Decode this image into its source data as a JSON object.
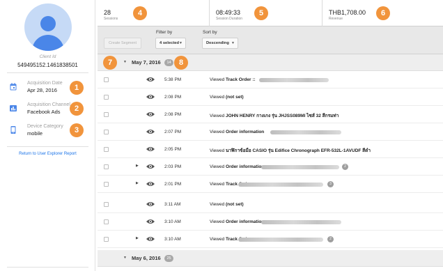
{
  "sidebar": {
    "client_label": "Client Id",
    "client_id": "549495152.1461838501",
    "attributes": [
      {
        "label": "Acquisition Date",
        "value": "Apr 28, 2016",
        "icon": "calendar-icon"
      },
      {
        "label": "Acquisition Channel",
        "value": "Facebook Ads",
        "icon": "bar-chart-icon"
      },
      {
        "label": "Device Category",
        "value": "mobile",
        "icon": "mobile-device-icon"
      }
    ],
    "return_link": "Return to User Explorer Report"
  },
  "summary": {
    "sessions": {
      "value": "28",
      "label": "Sessions"
    },
    "duration": {
      "value": "08:49:33",
      "label": "Session Duration"
    },
    "revenue": {
      "value": "THB1,708.00",
      "label": "Revenue"
    }
  },
  "toolbar": {
    "create_segment": "Create Segment",
    "filter_label": "Filter by",
    "filter_value": "4 selected",
    "sort_label": "Sort by",
    "sort_value": "Descending"
  },
  "groups": [
    {
      "date": "May 7, 2016",
      "count": "14"
    },
    {
      "date": "May 6, 2016",
      "count": "25"
    }
  ],
  "rows": [
    {
      "time": "5:38 PM",
      "prefix": "Viewed ",
      "bold": "Track Order ::",
      "rest": ""
    },
    {
      "time": "2:08 PM",
      "prefix": "Viewed ",
      "bold": "(not set)",
      "rest": ""
    },
    {
      "time": "2:08 PM",
      "prefix": "Viewed ",
      "bold": "JOHN HENRY กางเกง รุ่น JHJSS089MI ไซส์ 32 สีกรมท่า",
      "rest": ""
    },
    {
      "time": "2:07 PM",
      "prefix": "Viewed ",
      "bold": "Order information",
      "rest": ""
    },
    {
      "time": "2:05 PM",
      "prefix": "Viewed ",
      "bold": "นาฬิกาข้อมือ CASIO รุ่น Edifice Chronograph EFR-532L-1AVUDF สีดำ",
      "rest": ""
    },
    {
      "time": "2:03 PM",
      "prefix": "Viewed ",
      "bold": "Order information",
      "rest": "",
      "badge": "2"
    },
    {
      "time": "2:01 PM",
      "prefix": "Viewed ",
      "bold": "Track Order",
      "rest": "",
      "badge": "3"
    },
    {
      "time": "3:11 AM",
      "prefix": "Viewed ",
      "bold": "(not set)",
      "rest": ""
    },
    {
      "time": "3:10 AM",
      "prefix": "Viewed ",
      "bold": "Order information",
      "rest": ""
    },
    {
      "time": "3:10 AM",
      "prefix": "Viewed ",
      "bold": "Track Order",
      "rest": "",
      "badge": "2"
    }
  ],
  "callouts": [
    "1",
    "2",
    "3",
    "4",
    "5",
    "6",
    "7",
    "8"
  ],
  "colors": {
    "callout": "#f1943c",
    "link": "#1a73e8",
    "avatar_bg": "#c6daf6",
    "avatar_fg": "#4a86e8"
  }
}
